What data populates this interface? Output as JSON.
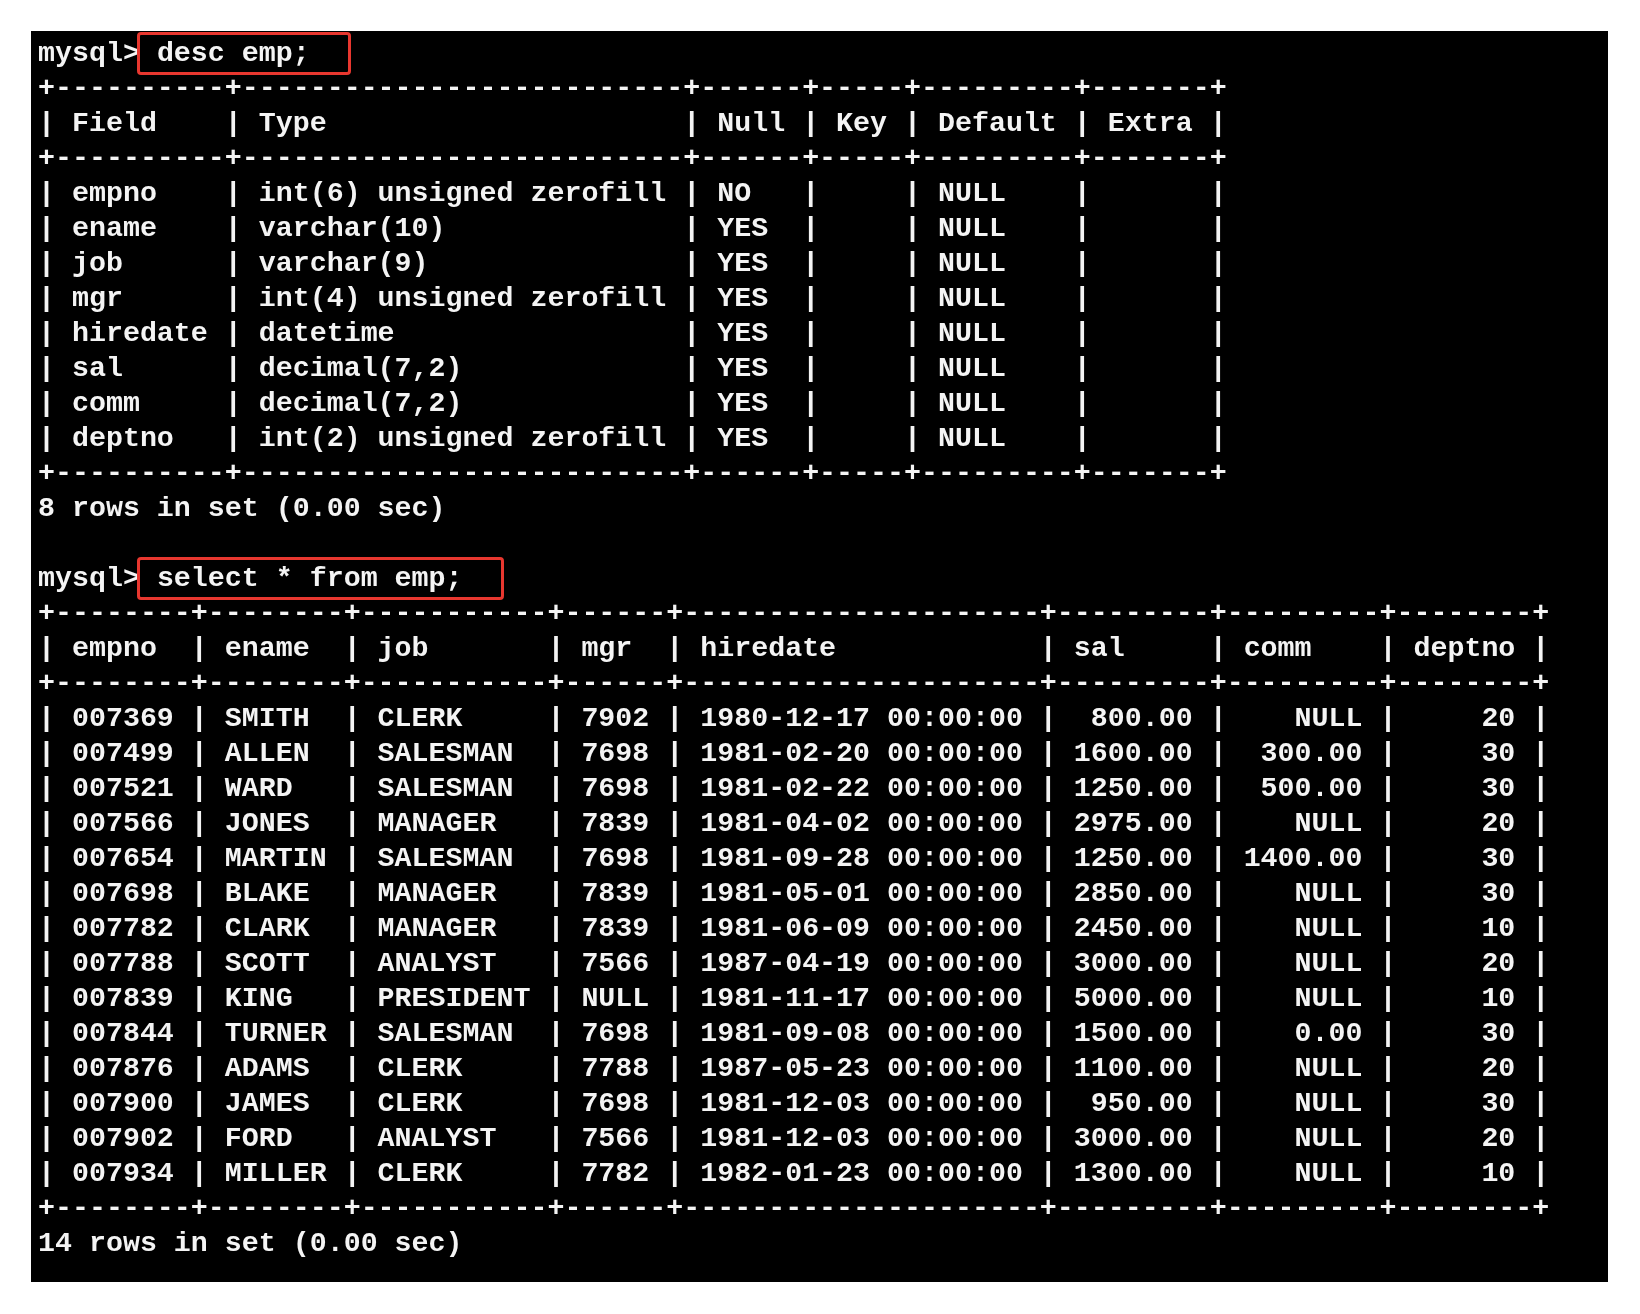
{
  "terminal": {
    "lines": [
      {
        "kind": "prompt",
        "prompt": "mysql>",
        "command": "desc emp;",
        "highlighted": true
      },
      {
        "kind": "border",
        "text": "+----------+--------------------------+------+-----+---------+-------+"
      },
      {
        "kind": "header",
        "text": "| Field    | Type                     | Null | Key | Default | Extra |"
      },
      {
        "kind": "border",
        "text": "+----------+--------------------------+------+-----+---------+-------+"
      },
      {
        "kind": "row",
        "text": "| empno    | int(6) unsigned zerofill | NO   |     | NULL    |       |"
      },
      {
        "kind": "row",
        "text": "| ename    | varchar(10)              | YES  |     | NULL    |       |"
      },
      {
        "kind": "row",
        "text": "| job      | varchar(9)               | YES  |     | NULL    |       |"
      },
      {
        "kind": "row",
        "text": "| mgr      | int(4) unsigned zerofill | YES  |     | NULL    |       |"
      },
      {
        "kind": "row",
        "text": "| hiredate | datetime                 | YES  |     | NULL    |       |"
      },
      {
        "kind": "row",
        "text": "| sal      | decimal(7,2)             | YES  |     | NULL    |       |"
      },
      {
        "kind": "row",
        "text": "| comm     | decimal(7,2)             | YES  |     | NULL    |       |"
      },
      {
        "kind": "row",
        "text": "| deptno   | int(2) unsigned zerofill | YES  |     | NULL    |       |"
      },
      {
        "kind": "border",
        "text": "+----------+--------------------------+------+-----+---------+-------+"
      },
      {
        "kind": "status",
        "text": "8 rows in set (0.00 sec)"
      },
      {
        "kind": "blank"
      },
      {
        "kind": "prompt",
        "prompt": "mysql>",
        "command": "select * from emp;",
        "highlighted": true
      },
      {
        "kind": "border",
        "text": "+--------+--------+-----------+------+---------------------+---------+---------+--------+"
      },
      {
        "kind": "header",
        "text": "| empno  | ename  | job       | mgr  | hiredate            | sal     | comm    | deptno |"
      },
      {
        "kind": "border",
        "text": "+--------+--------+-----------+------+---------------------+---------+---------+--------+"
      },
      {
        "kind": "row",
        "text": "| 007369 | SMITH  | CLERK     | 7902 | 1980-12-17 00:00:00 |  800.00 |    NULL |     20 |"
      },
      {
        "kind": "row",
        "text": "| 007499 | ALLEN  | SALESMAN  | 7698 | 1981-02-20 00:00:00 | 1600.00 |  300.00 |     30 |"
      },
      {
        "kind": "row",
        "text": "| 007521 | WARD   | SALESMAN  | 7698 | 1981-02-22 00:00:00 | 1250.00 |  500.00 |     30 |"
      },
      {
        "kind": "row",
        "text": "| 007566 | JONES  | MANAGER   | 7839 | 1981-04-02 00:00:00 | 2975.00 |    NULL |     20 |"
      },
      {
        "kind": "row",
        "text": "| 007654 | MARTIN | SALESMAN  | 7698 | 1981-09-28 00:00:00 | 1250.00 | 1400.00 |     30 |"
      },
      {
        "kind": "row",
        "text": "| 007698 | BLAKE  | MANAGER   | 7839 | 1981-05-01 00:00:00 | 2850.00 |    NULL |     30 |"
      },
      {
        "kind": "row",
        "text": "| 007782 | CLARK  | MANAGER   | 7839 | 1981-06-09 00:00:00 | 2450.00 |    NULL |     10 |"
      },
      {
        "kind": "row",
        "text": "| 007788 | SCOTT  | ANALYST   | 7566 | 1987-04-19 00:00:00 | 3000.00 |    NULL |     20 |"
      },
      {
        "kind": "row",
        "text": "| 007839 | KING   | PRESIDENT | NULL | 1981-11-17 00:00:00 | 5000.00 |    NULL |     10 |"
      },
      {
        "kind": "row",
        "text": "| 007844 | TURNER | SALESMAN  | 7698 | 1981-09-08 00:00:00 | 1500.00 |    0.00 |     30 |"
      },
      {
        "kind": "row",
        "text": "| 007876 | ADAMS  | CLERK     | 7788 | 1987-05-23 00:00:00 | 1100.00 |    NULL |     20 |"
      },
      {
        "kind": "row",
        "text": "| 007900 | JAMES  | CLERK     | 7698 | 1981-12-03 00:00:00 |  950.00 |    NULL |     30 |"
      },
      {
        "kind": "row",
        "text": "| 007902 | FORD   | ANALYST   | 7566 | 1981-12-03 00:00:00 | 3000.00 |    NULL |     20 |"
      },
      {
        "kind": "row",
        "text": "| 007934 | MILLER | CLERK     | 7782 | 1982-01-23 00:00:00 | 1300.00 |    NULL |     10 |"
      },
      {
        "kind": "border",
        "text": "+--------+--------+-----------+------+---------------------+---------+---------+--------+"
      },
      {
        "kind": "status",
        "text": "14 rows in set (0.00 sec)"
      }
    ]
  }
}
